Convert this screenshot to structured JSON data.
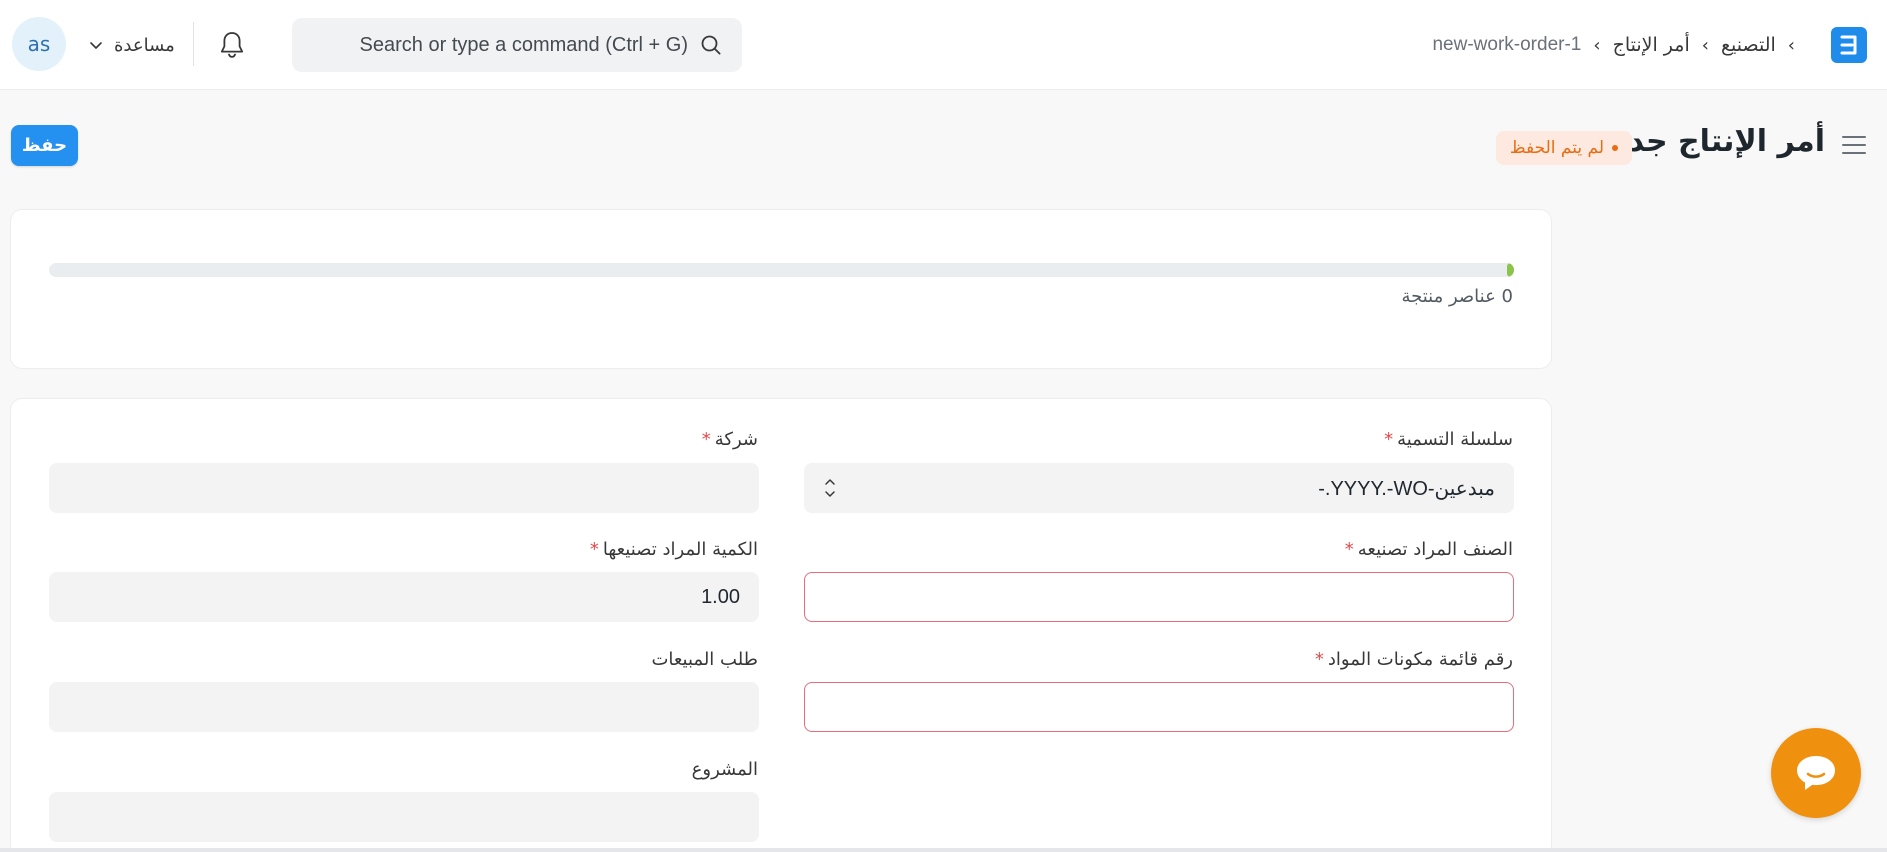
{
  "navbar": {
    "avatar_initials": "as",
    "help_label": "مساعدة",
    "search_placeholder": "Search or type a command (Ctrl + G)",
    "breadcrumb": [
      "التصنيع",
      "أمر الإنتاج",
      "new-work-order-1"
    ],
    "logo_letter": "E",
    "brand_color": "#1f8ceb"
  },
  "page": {
    "title": "أمر الإنتاج جديد",
    "status_indicator": "لم يتم الحفظ",
    "save_label": "حفظ"
  },
  "progress": {
    "fraction": 0.0,
    "label": "0 عناصر منتجة"
  },
  "form": {
    "naming_series": {
      "label": "سلسلة التسمية",
      "value": "مبدعين-YYYY.-WO.-",
      "required": true
    },
    "company": {
      "label": "شركة",
      "value": "",
      "required": true
    },
    "production_item": {
      "label": "الصنف المراد تصنيعه",
      "value": "",
      "required": true
    },
    "qty": {
      "label": "الكمية المراد تصنيعها",
      "value": "1.00",
      "required": true
    },
    "bom_no": {
      "label": "رقم قائمة مكونات المواد",
      "value": "",
      "required": true
    },
    "sales_order": {
      "label": "طلب المبيعات",
      "value": ""
    },
    "project": {
      "label": "المشروع",
      "value": ""
    }
  },
  "colors": {
    "primary": "#2490ef",
    "indicator_orange": "#e86c13",
    "progress_green": "#8ac44b",
    "error_border": "#e86c7a",
    "chat_orange": "#f0900f"
  }
}
